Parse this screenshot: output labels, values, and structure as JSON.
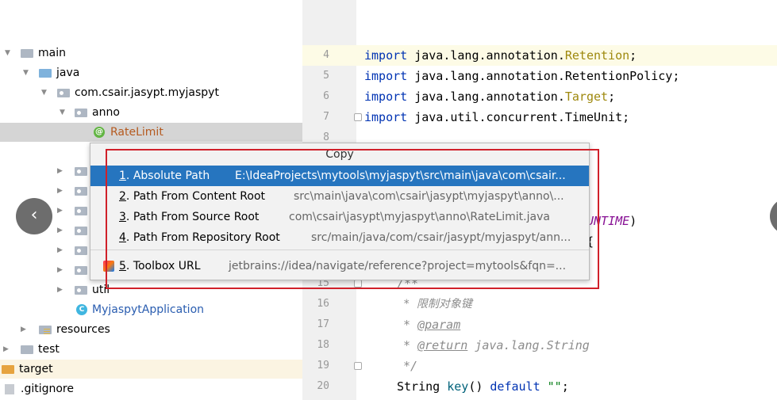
{
  "tree": {
    "items": [
      {
        "label": "main"
      },
      {
        "label": "java"
      },
      {
        "label": "com.csair.jasypt.myjaspyt"
      },
      {
        "label": "anno"
      },
      {
        "label": "RateLimit"
      },
      {
        "label": "util"
      },
      {
        "label": "MyjaspytApplication"
      },
      {
        "label": "resources"
      },
      {
        "label": "test"
      },
      {
        "label": "target"
      },
      {
        "label": ".gitignore"
      }
    ]
  },
  "editor": {
    "line_numbers": [
      "4",
      "5",
      "6",
      "7",
      "8",
      "15",
      "16",
      "17",
      "18",
      "19",
      "20"
    ],
    "lines": {
      "l4_kw": "import",
      "l4_pkg": " java.lang.annotation.",
      "l4_cls": "Retention",
      "l4_end": ";",
      "l5_kw": "import",
      "l5_pkg": " java.lang.annotation.RetentionPolicy;",
      "l6_kw": "import",
      "l6_pkg": " java.lang.annotation.",
      "l6_cls": "Target",
      "l6_end": ";",
      "l7_kw": "import",
      "l7_pkg": " java.util.concurrent.TimeUnit;",
      "frag_runtime": "UNTIME",
      "frag_paren": ")",
      "frag_brace": "{",
      "l15": "/**",
      "l16": "* 限制对象键",
      "l17_star": "* ",
      "l17_tag": "@param",
      "l18_star": "* ",
      "l18_tag": "@return",
      "l18_rest": " java.lang.String",
      "l19": "*/",
      "l20_type": "String ",
      "l20_fn": "key",
      "l20_mid": "() ",
      "l20_kw": "default",
      "l20_sp": " ",
      "l20_str": "\"\"",
      "l20_end": ";"
    }
  },
  "popup": {
    "title": "Copy",
    "items": [
      {
        "num": "1",
        "name": ". Absolute Path",
        "path": "E:\\IdeaProjects\\mytools\\myjaspyt\\src\\main\\java\\com\\csair..."
      },
      {
        "num": "2",
        "name": ". Path From Content Root",
        "path": "src\\main\\java\\com\\csair\\jasypt\\myjaspyt\\anno\\..."
      },
      {
        "num": "3",
        "name": ". Path From Source Root",
        "path": "com\\csair\\jasypt\\myjaspyt\\anno\\RateLimit.java"
      },
      {
        "num": "4",
        "name": ". Path From Repository Root",
        "path": "src/main/java/com/csair/jasypt/myjaspyt/ann..."
      },
      {
        "num": "5",
        "name": ". Toolbox URL",
        "path": "jetbrains://idea/navigate/reference?project=mytools&fqn=..."
      }
    ]
  },
  "colors": {
    "selection": "#2675bf",
    "highlight_box": "#d0202a",
    "keyword": "#0033b3",
    "annotation": "#9e880d"
  },
  "icons": {
    "nav_left": "‹"
  }
}
